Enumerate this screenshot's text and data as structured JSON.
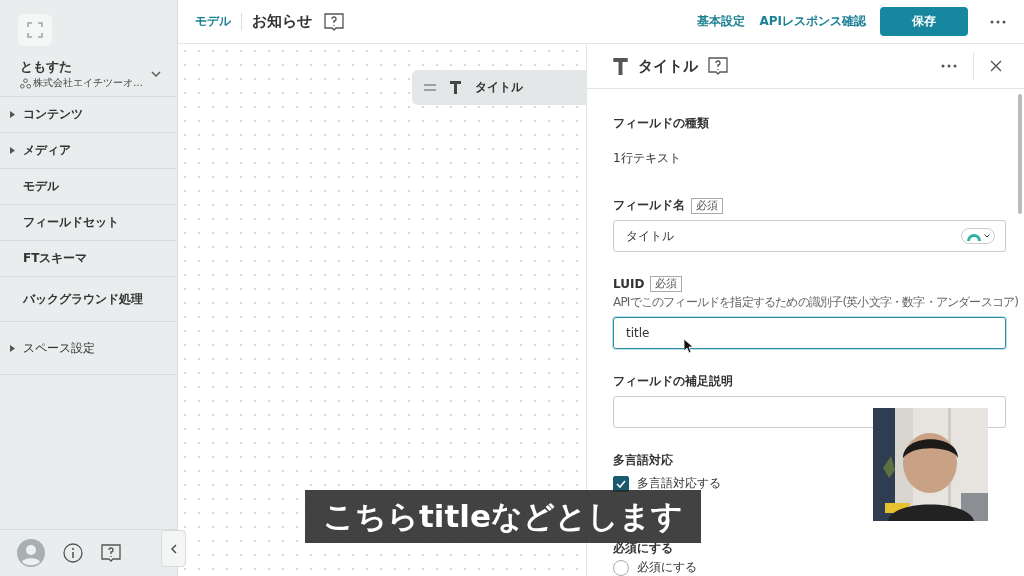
{
  "sidebar": {
    "user_name": "ともすた",
    "organization": "株式会社エイチツーオ…",
    "items": [
      {
        "label": "コンテンツ",
        "kind": "group"
      },
      {
        "label": "メディア",
        "kind": "group"
      },
      {
        "label": "モデル",
        "kind": "link"
      },
      {
        "label": "フィールドセット",
        "kind": "link"
      },
      {
        "label": "FTスキーマ",
        "kind": "link"
      },
      {
        "label": "バックグラウンド処理",
        "kind": "link"
      },
      {
        "label": "スペース設定",
        "kind": "group"
      }
    ]
  },
  "header": {
    "breadcrumb": "モデル",
    "title": "お知らせ",
    "links": [
      "基本設定",
      "APIレスポンス確認"
    ],
    "save_button": "保存"
  },
  "canvas": {
    "fields": [
      {
        "label": "タイトル"
      }
    ]
  },
  "panel": {
    "title": "タイトル",
    "sections": [
      {
        "kind": "static",
        "label": "フィールドの種類",
        "value": "1行テキスト"
      },
      {
        "kind": "input",
        "label": "フィールド名",
        "required_badge": "必須",
        "value": "タイトル",
        "icon_picker": true,
        "focused": false
      },
      {
        "kind": "input",
        "label": "LUID",
        "required_badge": "必須",
        "hint": "APIでこのフィールドを指定するための識別子(英小文字・数字・アンダースコア)",
        "value": "title",
        "icon_picker": false,
        "focused": true
      },
      {
        "kind": "input",
        "label": "フィールドの補足説明",
        "icon_picker": false,
        "focused": false
      },
      {
        "kind": "checkbox",
        "label": "多言語対応",
        "option": "多言語対応する",
        "checked": true
      },
      {
        "kind": "radio",
        "label": "必須にする",
        "option": "必須にする",
        "selected": false
      }
    ]
  },
  "caption": "こちらtitleなどとします"
}
